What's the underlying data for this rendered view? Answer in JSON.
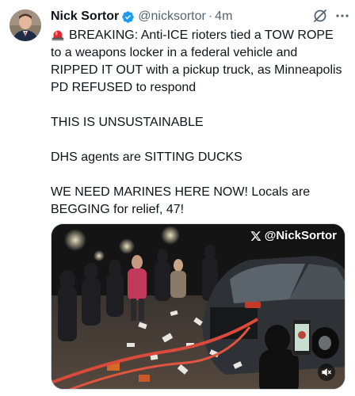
{
  "author": {
    "display_name": "Nick Sortor",
    "handle": "@nicksortor",
    "separator": "·",
    "time": "4m"
  },
  "tweet": {
    "line1": "BREAKING: Anti-ICE rioters tied a TOW ROPE to a weapons locker in a federal vehicle and RIPPED IT OUT with a pickup truck, as Minneapolis PD REFUSED to respond",
    "line2": "THIS IS UNSUSTAINABLE",
    "line3": "DHS agents are SITTING DUCKS",
    "line4": "WE NEED MARINES HERE NOW! Locals are BEGGING for relief, 47!"
  },
  "media": {
    "watermark": "@NickSortor"
  },
  "icons": {
    "verified": "verified-badge-icon",
    "grok": "grok-icon",
    "more": "more-icon",
    "siren": "siren-emoji-icon",
    "mute": "muted-speaker-icon",
    "x_logo": "x-logo-icon"
  },
  "colors": {
    "verified_blue": "#1d9bf0",
    "secondary_text": "#536471",
    "rope": "#d94a3a"
  }
}
